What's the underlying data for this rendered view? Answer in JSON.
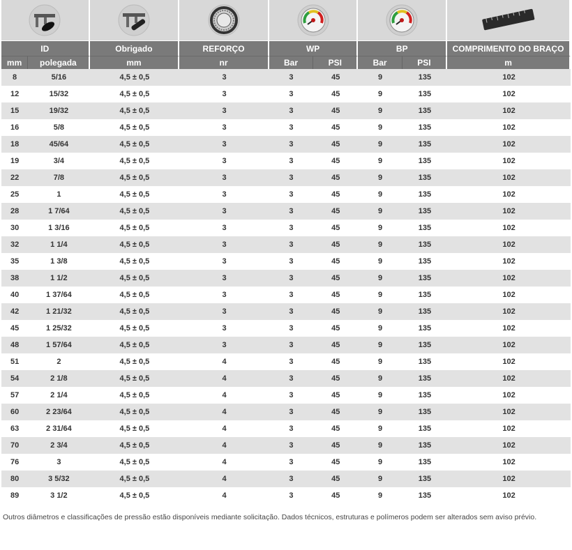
{
  "header": {
    "groups": [
      "ID",
      "Obrigado",
      "REFORÇO",
      "WP",
      "BP",
      "COMPRIMENTO DO BRAÇO"
    ],
    "units": [
      "mm",
      "polegada",
      "mm",
      "nr",
      "Bar",
      "PSI",
      "Bar",
      "PSI",
      "m"
    ]
  },
  "icons": [
    "caliper-id-icon",
    "caliper-thickness-icon",
    "reinforcement-coil-icon",
    "pressure-gauge-icon",
    "pressure-gauge-icon",
    "measuring-tape-icon"
  ],
  "colors": {
    "header_bg": "#7a7a7a",
    "icon_bg": "#d8d8d8",
    "row_alt": "#e2e2e2"
  },
  "rows": [
    [
      "8",
      "5/16",
      "4,5 ± 0,5",
      "3",
      "3",
      "45",
      "9",
      "135",
      "102"
    ],
    [
      "12",
      "15/32",
      "4,5 ± 0,5",
      "3",
      "3",
      "45",
      "9",
      "135",
      "102"
    ],
    [
      "15",
      "19/32",
      "4,5 ± 0,5",
      "3",
      "3",
      "45",
      "9",
      "135",
      "102"
    ],
    [
      "16",
      "5/8",
      "4,5 ± 0,5",
      "3",
      "3",
      "45",
      "9",
      "135",
      "102"
    ],
    [
      "18",
      "45/64",
      "4,5 ± 0,5",
      "3",
      "3",
      "45",
      "9",
      "135",
      "102"
    ],
    [
      "19",
      "3/4",
      "4,5 ± 0,5",
      "3",
      "3",
      "45",
      "9",
      "135",
      "102"
    ],
    [
      "22",
      "7/8",
      "4,5 ± 0,5",
      "3",
      "3",
      "45",
      "9",
      "135",
      "102"
    ],
    [
      "25",
      "1",
      "4,5 ± 0,5",
      "3",
      "3",
      "45",
      "9",
      "135",
      "102"
    ],
    [
      "28",
      "1 7/64",
      "4,5 ± 0,5",
      "3",
      "3",
      "45",
      "9",
      "135",
      "102"
    ],
    [
      "30",
      "1 3/16",
      "4,5 ± 0,5",
      "3",
      "3",
      "45",
      "9",
      "135",
      "102"
    ],
    [
      "32",
      "1 1/4",
      "4,5 ± 0,5",
      "3",
      "3",
      "45",
      "9",
      "135",
      "102"
    ],
    [
      "35",
      "1 3/8",
      "4,5 ± 0,5",
      "3",
      "3",
      "45",
      "9",
      "135",
      "102"
    ],
    [
      "38",
      "1 1/2",
      "4,5 ± 0,5",
      "3",
      "3",
      "45",
      "9",
      "135",
      "102"
    ],
    [
      "40",
      "1 37/64",
      "4,5 ± 0,5",
      "3",
      "3",
      "45",
      "9",
      "135",
      "102"
    ],
    [
      "42",
      "1 21/32",
      "4,5 ± 0,5",
      "3",
      "3",
      "45",
      "9",
      "135",
      "102"
    ],
    [
      "45",
      "1 25/32",
      "4,5 ± 0,5",
      "3",
      "3",
      "45",
      "9",
      "135",
      "102"
    ],
    [
      "48",
      "1 57/64",
      "4,5 ± 0,5",
      "3",
      "3",
      "45",
      "9",
      "135",
      "102"
    ],
    [
      "51",
      "2",
      "4,5 ± 0,5",
      "4",
      "3",
      "45",
      "9",
      "135",
      "102"
    ],
    [
      "54",
      "2 1/8",
      "4,5 ± 0,5",
      "4",
      "3",
      "45",
      "9",
      "135",
      "102"
    ],
    [
      "57",
      "2 1/4",
      "4,5 ± 0,5",
      "4",
      "3",
      "45",
      "9",
      "135",
      "102"
    ],
    [
      "60",
      "2 23/64",
      "4,5 ± 0,5",
      "4",
      "3",
      "45",
      "9",
      "135",
      "102"
    ],
    [
      "63",
      "2 31/64",
      "4,5 ± 0,5",
      "4",
      "3",
      "45",
      "9",
      "135",
      "102"
    ],
    [
      "70",
      "2 3/4",
      "4,5 ± 0,5",
      "4",
      "3",
      "45",
      "9",
      "135",
      "102"
    ],
    [
      "76",
      "3",
      "4,5 ± 0,5",
      "4",
      "3",
      "45",
      "9",
      "135",
      "102"
    ],
    [
      "80",
      "3 5/32",
      "4,5 ± 0,5",
      "4",
      "3",
      "45",
      "9",
      "135",
      "102"
    ],
    [
      "89",
      "3 1/2",
      "4,5 ± 0,5",
      "4",
      "3",
      "45",
      "9",
      "135",
      "102"
    ]
  ],
  "footnote": "Outros diâmetros e classificações de pressão estão disponíveis mediante solicitação. Dados técnicos, estruturas e polímeros podem ser alterados sem aviso prévio."
}
